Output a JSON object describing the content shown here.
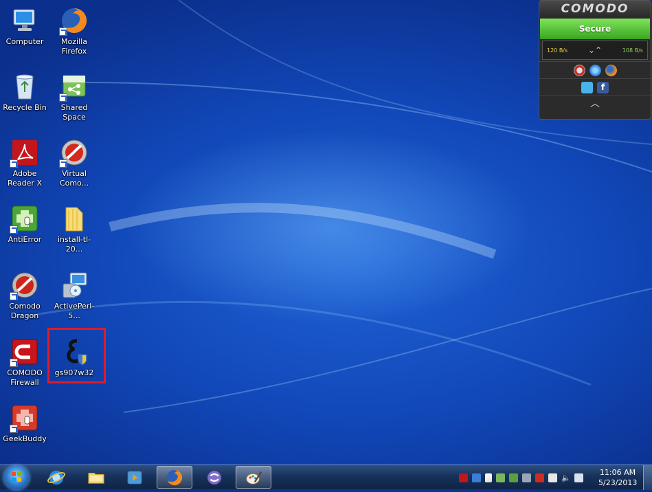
{
  "desktop_icons": [
    {
      "name": "computer",
      "label": "Computer"
    },
    {
      "name": "mozilla-firefox",
      "label": "Mozilla Firefox"
    },
    {
      "name": "recycle-bin",
      "label": "Recycle Bin"
    },
    {
      "name": "shared-space",
      "label": "Shared Space"
    },
    {
      "name": "adobe-reader-x",
      "label": "Adobe Reader X"
    },
    {
      "name": "virtual-comodo",
      "label": "Virtual Como..."
    },
    {
      "name": "antierror",
      "label": "AntiError"
    },
    {
      "name": "install-tl",
      "label": "install-tl-20..."
    },
    {
      "name": "comodo-dragon",
      "label": "Comodo Dragon"
    },
    {
      "name": "activeperl",
      "label": "ActivePerl-5..."
    },
    {
      "name": "comodo-firewall",
      "label": "COMODO Firewall"
    },
    {
      "name": "gs907w32",
      "label": "gs907w32"
    },
    {
      "name": "geekbuddy",
      "label": "GeekBuddy"
    }
  ],
  "comodo_widget": {
    "brand": "COMODO",
    "status": "Secure",
    "traffic_in": "120 B/s",
    "traffic_out": "108 B/s",
    "accent_color": "#5cc33b"
  },
  "taskbar": {
    "clock_time": "11:06 AM",
    "clock_date": "5/23/2013",
    "pinned": [
      "internet-explorer-icon",
      "explorer-folder-icon",
      "media-player-icon",
      "firefox-icon",
      "comodo-app-icon",
      "paint-icon"
    ]
  },
  "colors": {
    "desktop_blue": "#1147b8",
    "selection_border": "#e01b2a"
  }
}
